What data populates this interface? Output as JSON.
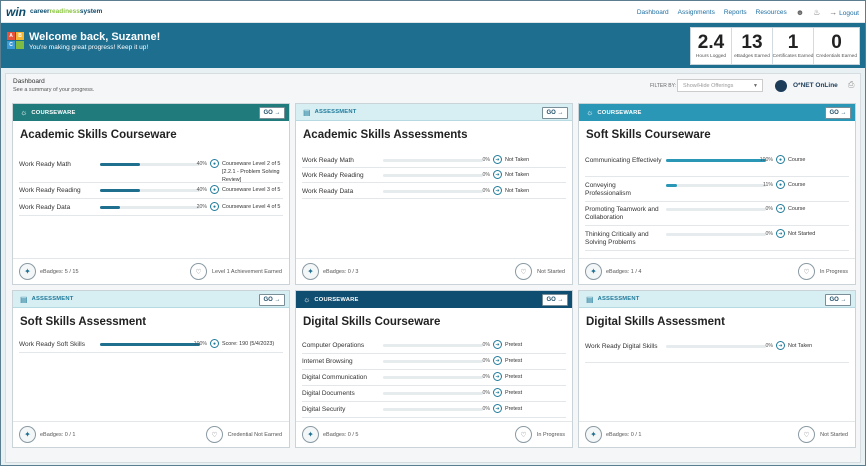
{
  "app": {
    "logo_win": "win",
    "logo_text_1": "career",
    "logo_text_2": "readiness",
    "logo_text_3": "system"
  },
  "nav": {
    "items": [
      "Dashboard",
      "Assignments",
      "Reports",
      "Resources"
    ],
    "logout": "Logout"
  },
  "banner": {
    "welcome": "Welcome back, Suzanne!",
    "sub": "You're making great progress! Keep it up!"
  },
  "stats": [
    {
      "value": "2.4",
      "label": "Hours Logged"
    },
    {
      "value": "13",
      "label": "eBadges Earned"
    },
    {
      "value": "1",
      "label": "Certificates Earned"
    },
    {
      "value": "0",
      "label": "Credentials Earned"
    }
  ],
  "dashboard": {
    "title": "Dashboard",
    "subtitle": "See a summary of your progress.",
    "filter_label": "FILTER BY:",
    "filter_placeholder": "Show/Hide Offerings",
    "onet": "O*NET OnLine"
  },
  "go_label": "GO →",
  "cards": [
    {
      "type": "COURSEWARE",
      "title": "Academic Skills Courseware",
      "badges": "eBadges: 5 / 15",
      "status": "Level 1 Achievement Earned",
      "rows": [
        {
          "name": "Work Ready Math",
          "pct": "40%",
          "pct_val": 40,
          "status": "Courseware Level 2 of 5 [2.2.1 - Problem Solving Review]"
        },
        {
          "name": "Work Ready Reading",
          "pct": "40%",
          "pct_val": 40,
          "status": "Courseware Level 3 of 5"
        },
        {
          "name": "Work Ready Data",
          "pct": "20%",
          "pct_val": 20,
          "status": "Courseware Level 4 of 5"
        }
      ]
    },
    {
      "type": "ASSESSMENT",
      "title": "Academic Skills Assessments",
      "badges": "eBadges: 0 / 3",
      "status": "Not Started",
      "rows": [
        {
          "name": "Work Ready Math",
          "pct": "0%",
          "pct_val": 0,
          "status": "Not Taken"
        },
        {
          "name": "Work Ready Reading",
          "pct": "0%",
          "pct_val": 0,
          "status": "Not Taken"
        },
        {
          "name": "Work Ready Data",
          "pct": "0%",
          "pct_val": 0,
          "status": "Not Taken"
        }
      ]
    },
    {
      "type": "COURSEWARE",
      "title": "Soft Skills Courseware",
      "badges": "eBadges: 1 / 4",
      "status": "In Progress",
      "rows": [
        {
          "name": "Communicating Effectively",
          "pct": "100%",
          "pct_val": 100,
          "status": "Course"
        },
        {
          "name": "Conveying Professionalism",
          "pct": "11%",
          "pct_val": 11,
          "status": "Course"
        },
        {
          "name": "Promoting Teamwork and Collaboration",
          "pct": "0%",
          "pct_val": 0,
          "status": "Course"
        },
        {
          "name": "Thinking Critically and Solving Problems",
          "pct": "0%",
          "pct_val": 0,
          "status": "Not Started"
        }
      ]
    },
    {
      "type": "ASSESSMENT",
      "title": "Soft Skills Assessment",
      "badges": "eBadges: 0 / 1",
      "status": "Credential Not Earned",
      "rows": [
        {
          "name": "Work Ready Soft Skills",
          "pct": "100%",
          "pct_val": 100,
          "status": "Score: 190 (5/4/2023)"
        }
      ]
    },
    {
      "type": "COURSEWARE",
      "title": "Digital Skills Courseware",
      "badges": "eBadges: 0 / 5",
      "status": "In Progress",
      "rows": [
        {
          "name": "Computer Operations",
          "pct": "0%",
          "pct_val": 0,
          "status": "Pretest"
        },
        {
          "name": "Internet Browsing",
          "pct": "0%",
          "pct_val": 0,
          "status": "Pretest"
        },
        {
          "name": "Digital Communication",
          "pct": "0%",
          "pct_val": 0,
          "status": "Pretest"
        },
        {
          "name": "Digital Documents",
          "pct": "0%",
          "pct_val": 0,
          "status": "Pretest"
        },
        {
          "name": "Digital Security",
          "pct": "0%",
          "pct_val": 0,
          "status": "Pretest"
        }
      ]
    },
    {
      "type": "ASSESSMENT",
      "title": "Digital Skills Assessment",
      "badges": "eBadges: 0 / 1",
      "status": "Not Started",
      "rows": [
        {
          "name": "Work Ready Digital Skills",
          "pct": "0%",
          "pct_val": 0,
          "status": "Not Taken"
        }
      ]
    }
  ]
}
